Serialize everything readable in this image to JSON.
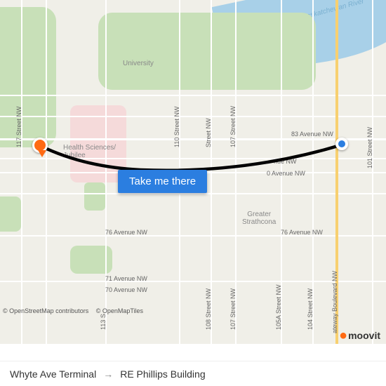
{
  "river_label": "Saskatchewan River",
  "cta_label": "Take me there",
  "attribution": {
    "osm": "© OpenStreetMap contributors",
    "tiles": "© OpenMapTiles"
  },
  "footer": {
    "origin": "Whyte Ave Terminal",
    "destination": "RE Phillips Building"
  },
  "brand": "moovit",
  "neighborhoods": {
    "university": "University",
    "health_sciences": "Health Sciences/\nJubilee",
    "strathcona": "Greater\nStrathcona"
  },
  "street_labels": {
    "s117": "117 Street NW",
    "s113": "113 S",
    "s110": "110 Street NW",
    "s108": "108 Street NW",
    "s107_top": "107 Street NW",
    "s107_bot": "107 Street NW",
    "s105a": "105A Street NW",
    "s104": "104 Street NW",
    "s101": "101 Street NW",
    "street_top": "Street NW",
    "ave83": "83 Avenue NW",
    "ave_nw": "nue NW",
    "ave80": "0 Avenue NW",
    "ave76_l": "76 Avenue NW",
    "ave76_r": "76 Avenue NW",
    "ave71": "71 Avenue NW",
    "ave70": "70 Avenue NW",
    "gateway": "ateway Boulevard NW"
  },
  "colors": {
    "route": "#000000",
    "cta_bg": "#2b7ee0",
    "pin_start": "#2b7ee0",
    "pin_end": "#ff6a13"
  }
}
